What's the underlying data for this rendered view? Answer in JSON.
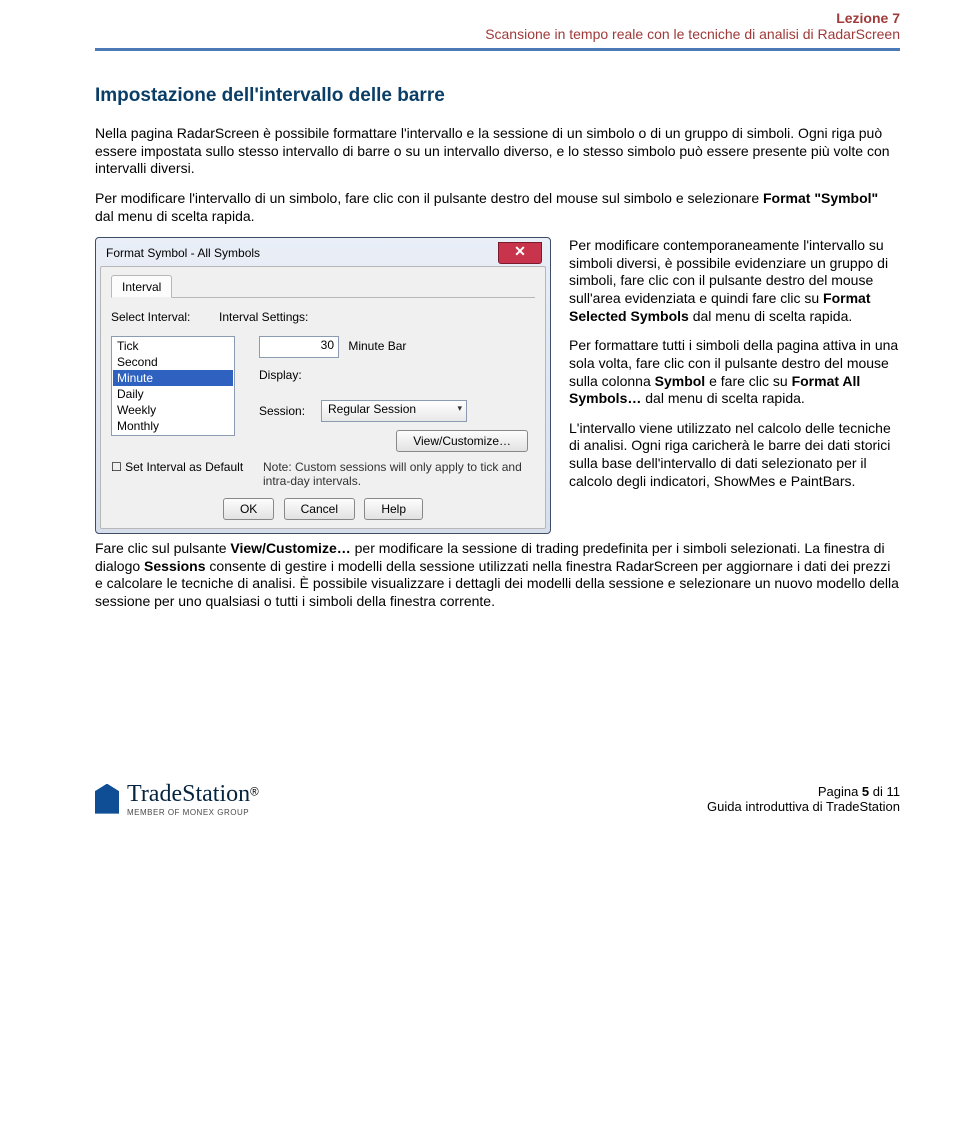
{
  "header": {
    "lezione": "Lezione 7",
    "subtitle": "Scansione in tempo reale con le tecniche di analisi di RadarScreen"
  },
  "title": "Impostazione dell'intervallo delle barre",
  "paragraphs": {
    "p1": "Nella pagina RadarScreen è possibile formattare l'intervallo e la sessione di un simbolo o di un gruppo di simboli. Ogni riga può essere impostata sullo stesso intervallo di barre o su un intervallo diverso, e lo stesso simbolo può essere presente più volte con intervalli diversi.",
    "p2_a": "Per modificare l'intervallo di un simbolo, fare clic con il pulsante destro del mouse sul simbolo e selezionare ",
    "p2_b": "Format \"Symbol\"",
    "p2_c": " dal menu di scelta rapida.",
    "p3_a": "Per modificare contemporaneamente l'intervallo su simboli diversi, è possibile evidenziare un gruppo di simboli, fare clic con il pulsante destro del mouse sull'area evidenziata e quindi fare clic su ",
    "p3_b": "Format Selected Symbols",
    "p3_c": " dal menu di scelta rapida.",
    "p4_a": "Per formattare tutti i simboli della pagina attiva in una sola volta, fare clic con il pulsante destro del mouse sulla colonna ",
    "p4_b": "Symbol",
    "p4_c": " e fare clic su ",
    "p4_d": "Format All Symbols…",
    "p4_e": " dal menu di scelta rapida.",
    "p5": "L'intervallo viene utilizzato nel calcolo delle tecniche di analisi. Ogni riga caricherà le barre dei dati storici sulla base dell'intervallo di dati selezionato per il calcolo degli indicatori, ShowMes e PaintBars.",
    "p6_a": "Fare clic sul pulsante ",
    "p6_b": "View/Customize…",
    "p6_c": " per modificare la sessione di trading predefinita per i simboli selezionati. La finestra di dialogo ",
    "p6_d": "Sessions",
    "p6_e": " consente di gestire i modelli della sessione utilizzati nella finestra RadarScreen per aggiornare i dati dei prezzi e calcolare le tecniche di analisi. È possibile visualizzare i dettagli dei modelli della sessione e selezionare un nuovo modello della sessione per uno qualsiasi o tutti i simboli della finestra corrente."
  },
  "dialog": {
    "title": "Format Symbol - All Symbols",
    "tab": "Interval",
    "labels": {
      "select_interval": "Select Interval:",
      "interval_settings": "Interval Settings:",
      "display": "Display:",
      "session": "Session:",
      "units_suffix": "Minute Bar",
      "set_default": "Set Interval as Default",
      "note": "Note: Custom sessions will only apply to tick and intra-day intervals."
    },
    "list": [
      "Tick",
      "Second",
      "Minute",
      "Daily",
      "Weekly",
      "Monthly"
    ],
    "selected": "Minute",
    "value": "30",
    "session_value": "Regular Session",
    "buttons": {
      "view": "View/Customize…",
      "ok": "OK",
      "cancel": "Cancel",
      "help": "Help"
    }
  },
  "footer": {
    "brand": "TradeStation",
    "reg": "®",
    "member": "MEMBER OF MONEX GROUP",
    "page_a": "Pagina ",
    "page_num": "5",
    "page_b": " di 11",
    "guide": "Guida introduttiva di TradeStation"
  }
}
